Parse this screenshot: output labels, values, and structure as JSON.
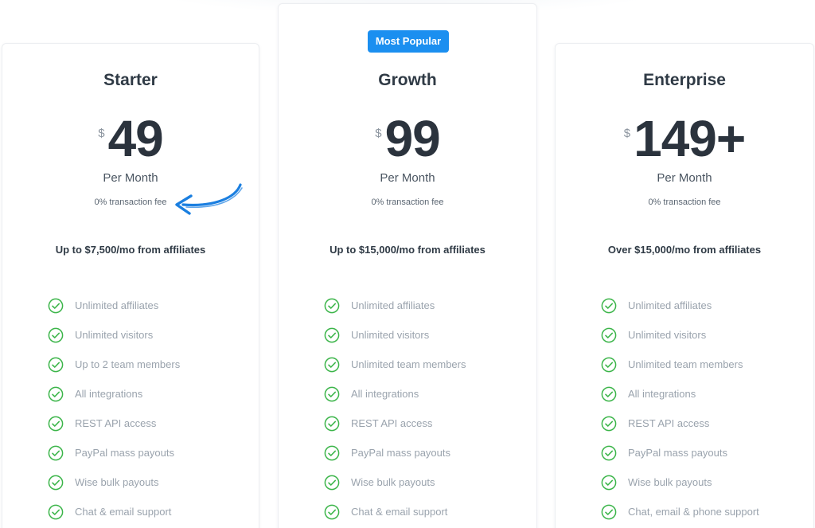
{
  "plans": [
    {
      "name": "Starter",
      "currency": "$",
      "price": "49",
      "period": "Per Month",
      "fee": "0% transaction fee",
      "limit": "Up to $7,500/mo from affiliates",
      "features": [
        "Unlimited affiliates",
        "Unlimited visitors",
        "Up to 2 team members",
        "All integrations",
        "REST API access",
        "PayPal mass payouts",
        "Wise bulk payouts",
        "Chat & email support"
      ]
    },
    {
      "badge": "Most Popular",
      "name": "Growth",
      "currency": "$",
      "price": "99",
      "period": "Per Month",
      "fee": "0% transaction fee",
      "limit": "Up to $15,000/mo from affiliates",
      "features": [
        "Unlimited affiliates",
        "Unlimited visitors",
        "Unlimited team members",
        "All integrations",
        "REST API access",
        "PayPal mass payouts",
        "Wise bulk payouts",
        "Chat & email support"
      ]
    },
    {
      "name": "Enterprise",
      "currency": "$",
      "price": "149+",
      "period": "Per Month",
      "fee": "0% transaction fee",
      "limit": "Over $15,000/mo from affiliates",
      "features": [
        "Unlimited affiliates",
        "Unlimited visitors",
        "Unlimited team members",
        "All integrations",
        "REST API access",
        "PayPal mass payouts",
        "Wise bulk payouts",
        "Chat, email & phone support"
      ]
    }
  ],
  "colors": {
    "accent": "#1b8ff0",
    "check": "#3cb54a",
    "arrow": "#1b7fe0",
    "heading": "#2f3a45",
    "feature_text": "#9aa3ad"
  },
  "icons": {
    "feature_check": "check-circle-icon",
    "annotation": "curved-arrow-icon"
  }
}
